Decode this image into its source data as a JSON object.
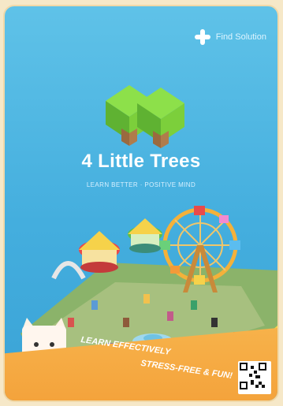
{
  "brand": {
    "name": "Find Solution",
    "icon": "plus-icon"
  },
  "app": {
    "title": "4 Little Trees",
    "tagline": "LEARN BETTER · POSITIVE MIND"
  },
  "banner": {
    "line1": "LEARN EFFECTIVELY",
    "line2": "STRESS-FREE & FUN!"
  },
  "colors": {
    "sky": "#44aede",
    "banner": "#f4a33c",
    "tree": "#7ccf3b"
  },
  "icons": [
    "plus-icon",
    "logo-trees",
    "qr-code"
  ]
}
